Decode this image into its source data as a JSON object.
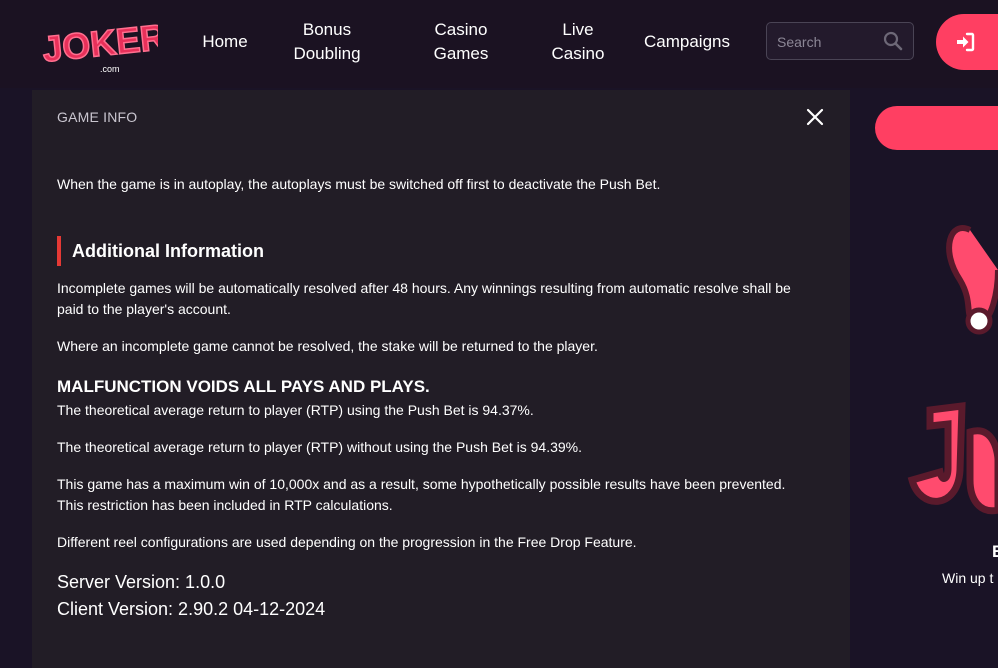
{
  "header": {
    "logo_text": "JOKERI",
    "logo_subtext": ".com",
    "nav": [
      {
        "line1": "Home",
        "line2": ""
      },
      {
        "line1": "Bonus",
        "line2": "Doubling"
      },
      {
        "line1": "Casino",
        "line2": "Games"
      },
      {
        "line1": "Live",
        "line2": "Casino"
      },
      {
        "line1": "Campaigns",
        "line2": ""
      }
    ],
    "search": {
      "placeholder": "Search",
      "value": "",
      "icon": "search-icon"
    },
    "login": {
      "icon": "login-icon"
    }
  },
  "modal": {
    "title": "GAME INFO",
    "close_icon": "close-icon",
    "paragraph_autoplay": "When the game is in autoplay, the autoplays must be switched off first to deactivate the Push Bet.",
    "section_heading": "Additional Information",
    "paragraph_incomplete": "Incomplete games will be automatically resolved after 48 hours. Any winnings resulting from automatic resolve shall be paid to the player's account.",
    "paragraph_unresolved": "Where an incomplete game cannot be resolved, the stake will be returned to the player.",
    "malfunction": "MALFUNCTION VOIDS ALL PAYS AND PLAYS.",
    "rtp_with": "The theoretical average return to player (RTP) using the Push Bet is 94.37%.",
    "rtp_without": "The theoretical average return to player (RTP) without using the Push Bet is 94.39%.",
    "max_win": "This game has a maximum win of 10,000x and as a result, some hypothetically possible results have been prevented. This restriction has been included in RTP calculations.",
    "reel_config": "Different reel configurations are used depending on the progression in the Free Drop Feature.",
    "server_version": "Server Version: 1.0.0",
    "client_version": "Client Version: 2.90.2 04-12-2024"
  },
  "side": {
    "letter": "E",
    "promo": "Win up t"
  },
  "colors": {
    "background": "#1a1326",
    "modal_bg": "#221d26",
    "accent": "#ff3f62",
    "heading_bar": "#e53935"
  }
}
